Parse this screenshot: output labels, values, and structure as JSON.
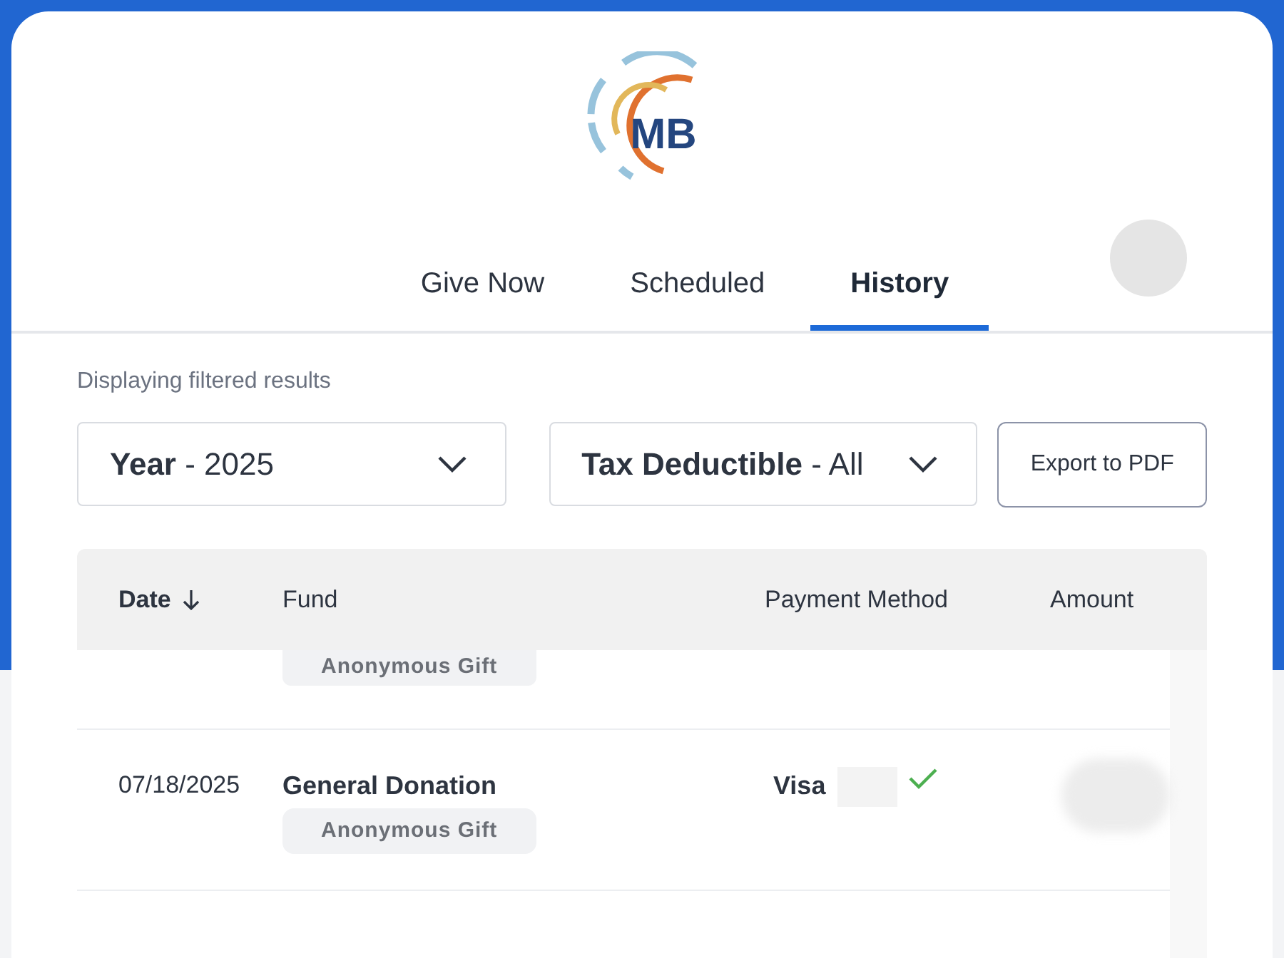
{
  "logo": {
    "text": "MB"
  },
  "tabs": [
    {
      "label": "Give Now",
      "selected": false
    },
    {
      "label": "Scheduled",
      "selected": false
    },
    {
      "label": "History",
      "selected": true
    }
  ],
  "filter_note": "Displaying filtered results",
  "filters": [
    {
      "label": "**Year** - 2025"
    },
    {
      "label": "**Tax Deductible** - All"
    }
  ],
  "export_button": "Export to PDF",
  "table": {
    "columns": [
      {
        "label": "Date",
        "sorted": true
      },
      {
        "label": "Fund",
        "sorted": false
      },
      {
        "label": "Payment Method",
        "sorted": false
      },
      {
        "label": "Amount",
        "sorted": false
      }
    ],
    "rows": [
      {
        "kind": "partial",
        "tag": "Anonymous Gift"
      },
      {
        "kind": "full",
        "date": "07/18/2025",
        "fund": "General Donation",
        "tag": "Anonymous Gift",
        "method": "Visa",
        "verified": true
      },
      {
        "kind": "hidden"
      }
    ]
  }
}
